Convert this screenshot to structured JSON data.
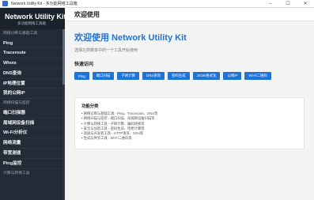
{
  "window": {
    "title": "Network Utility Kit - 多功能网络工具箱",
    "controls": [
      "–",
      "☐",
      "✕"
    ]
  },
  "sidebar": {
    "brand_title": "Network Utility Kit",
    "brand_subtitle": "多功能网络工具箱",
    "entries": [
      {
        "type": "section",
        "label": "网络诊断与基础工具"
      },
      {
        "type": "item",
        "label": "Ping"
      },
      {
        "type": "item",
        "label": "Traceroute"
      },
      {
        "type": "item",
        "label": "Whois"
      },
      {
        "type": "item",
        "label": "DNS查询"
      },
      {
        "type": "item",
        "label": "IP地理位置"
      },
      {
        "type": "item",
        "label": "我的公网IP"
      },
      {
        "type": "section",
        "label": "网络扫描与监控"
      },
      {
        "type": "item",
        "label": "端口扫描器"
      },
      {
        "type": "item",
        "label": "局域网设备扫描"
      },
      {
        "type": "item",
        "label": "Wi-Fi分析仪"
      },
      {
        "type": "item",
        "label": "网络流量"
      },
      {
        "type": "item",
        "label": "带宽测速"
      },
      {
        "type": "item",
        "label": "Ping监控"
      },
      {
        "type": "section",
        "label": "计算与转换工具"
      }
    ]
  },
  "header": {
    "title": "欢迎使用"
  },
  "main": {
    "welcome_title": "欢迎使用 Network Utility Kit",
    "welcome_subtitle": "选择左侧菜单中的一个工具开始使用",
    "quick_access_title": "快速访问",
    "quick_access": [
      "Ping",
      "端口扫描",
      "子网计算",
      "DNS查询",
      "密码生成",
      "JSON格式化",
      "公网IP",
      "Wi-Fi二维码"
    ],
    "features_title": "功能分类",
    "features": [
      "• 网络诊断与基础工具 - Ping、Traceroute、DNS等",
      "• 网络扫描与监控 - 端口扫描、局域网设备扫描等",
      "• 计算与转换工具 - 子网计算、编码转换等",
      "• 安全与加密工具 - 密码生成、哈希计算等",
      "• 高级与开发者工具 - HTTP请求、SSH等",
      "• 生成与共享工具 - Wi-Fi二维码等"
    ]
  }
}
